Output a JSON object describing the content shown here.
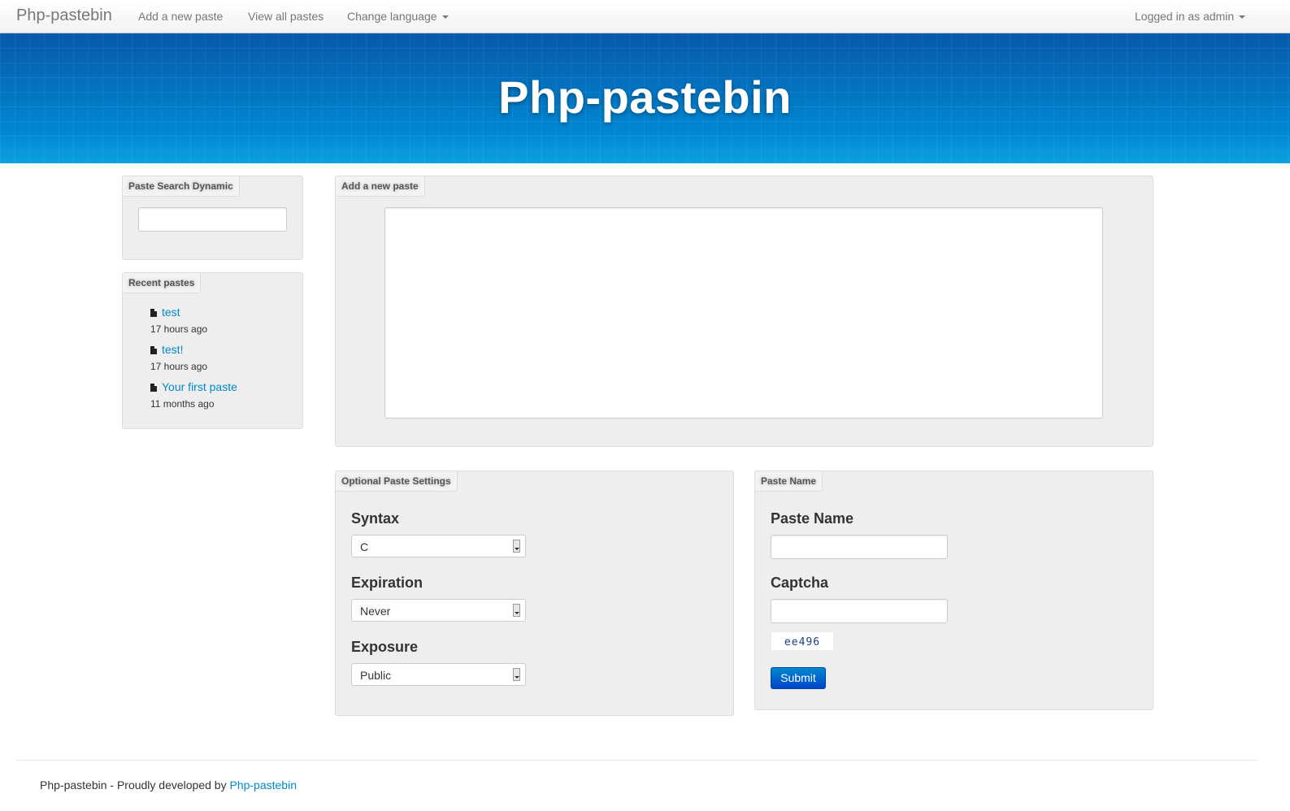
{
  "navbar": {
    "brand": "Php-pastebin",
    "add_new_paste": "Add a new paste",
    "view_all_pastes": "View all pastes",
    "change_language": "Change language",
    "logged_in": "Logged in as admin"
  },
  "hero": {
    "title": "Php-pastebin"
  },
  "search_panel": {
    "title": "Paste Search Dynamic",
    "value": ""
  },
  "recent_panel": {
    "title": "Recent pastes",
    "items": [
      {
        "label": "test",
        "time": "17 hours ago"
      },
      {
        "label": "test!",
        "time": "17 hours ago"
      },
      {
        "label": "Your first paste",
        "time": "11 months ago"
      }
    ]
  },
  "new_paste_panel": {
    "title": "Add a new paste",
    "content": ""
  },
  "settings_panel": {
    "title": "Optional Paste Settings",
    "syntax_label": "Syntax",
    "syntax_value": "C",
    "expiration_label": "Expiration",
    "expiration_value": "Never",
    "exposure_label": "Exposure",
    "exposure_value": "Public"
  },
  "name_panel": {
    "title": "Paste Name",
    "name_label": "Paste Name",
    "name_value": "",
    "captcha_label": "Captcha",
    "captcha_value": "",
    "captcha_code": "ee496",
    "submit_label": "Submit"
  },
  "footer": {
    "text": "Php-pastebin - Proudly developed by",
    "link": "Php-pastebin"
  },
  "colors": {
    "link": "#0088cc",
    "hero_blue": "#0a7bd0",
    "submit_blue": "#0044cc",
    "panel_bg": "#eeeeee"
  }
}
